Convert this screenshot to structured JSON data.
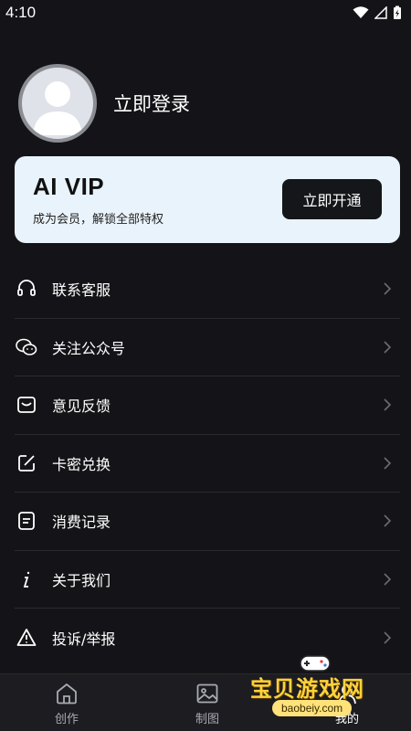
{
  "status_bar": {
    "time": "4:10"
  },
  "profile": {
    "login_label": "立即登录"
  },
  "vip_card": {
    "title": "AI VIP",
    "subtitle": "成为会员，解锁全部特权",
    "button_label": "立即开通"
  },
  "menu": {
    "items": [
      {
        "label": "联系客服",
        "icon": "headset-icon"
      },
      {
        "label": "关注公众号",
        "icon": "wechat-icon"
      },
      {
        "label": "意见反馈",
        "icon": "feedback-icon"
      },
      {
        "label": "卡密兑换",
        "icon": "edit-icon"
      },
      {
        "label": "消费记录",
        "icon": "record-icon"
      },
      {
        "label": "关于我们",
        "icon": "info-icon"
      },
      {
        "label": "投诉/举报",
        "icon": "warning-icon"
      }
    ]
  },
  "tab_bar": {
    "tabs": [
      {
        "label": "创作",
        "icon": "home-icon"
      },
      {
        "label": "制图",
        "icon": "image-icon"
      },
      {
        "label": "我的",
        "icon": "profile-icon",
        "active": true
      }
    ]
  },
  "watermark": {
    "text": "宝贝游戏网",
    "url": "baobeiy.com"
  }
}
